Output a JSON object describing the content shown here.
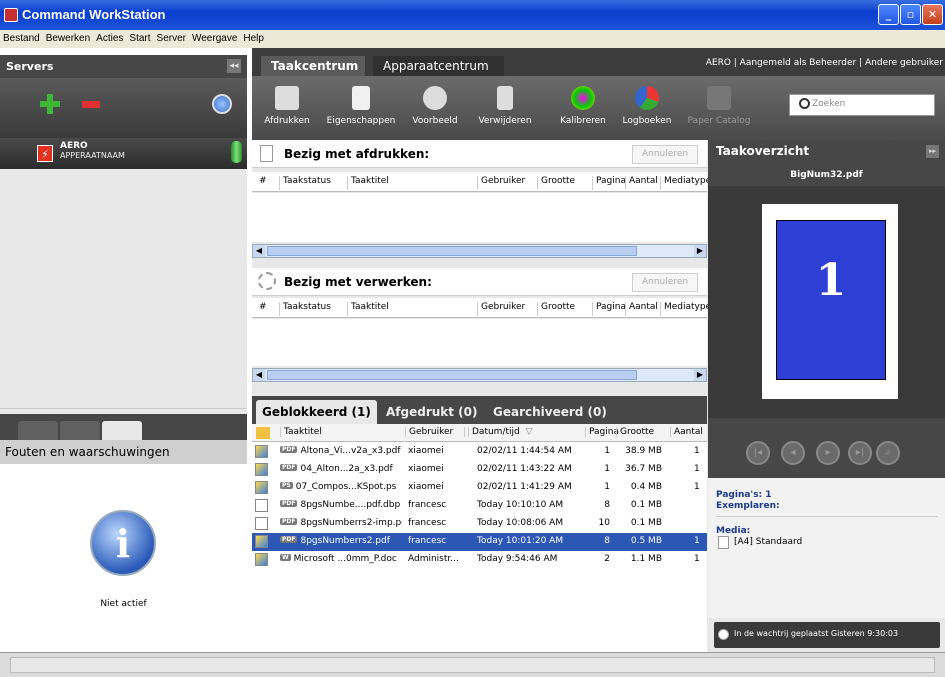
{
  "window": {
    "title": "Command WorkStation",
    "min": "_",
    "max": "▫",
    "close": "✕"
  },
  "menu": [
    "Bestand",
    "Bewerken",
    "Acties",
    "Start",
    "Server",
    "Weergave",
    "Help"
  ],
  "servers": {
    "header": "Servers",
    "collapse": "◂◂",
    "server_name": "AERO",
    "server_label": "APPERAATNAAM"
  },
  "left_tabs": [
    "job-list",
    "messages",
    "info"
  ],
  "fouten": {
    "header": "Fouten en waarschuwingen",
    "status": "Niet actief",
    "icon_glyph": "i"
  },
  "top_tabs": {
    "taak": "Taakcentrum",
    "apparaat": "Apparaatcentrum"
  },
  "user_status": "AERO | Aangemeld als Beheerder | Andere gebruiker",
  "toolbar": {
    "afdrukken": "Afdrukken",
    "eigenschappen": "Eigenschappen",
    "voorbeeld": "Voorbeeld",
    "verwijderen": "Verwijderen",
    "kalibreren": "Kalibreren",
    "logboeken": "Logboeken",
    "paper_catalog": "Paper Catalog",
    "search_placeholder": "Zoeken"
  },
  "printing": {
    "title": "Bezig met afdrukken:",
    "cancel": "Annuleren"
  },
  "processing": {
    "title": "Bezig met verwerken:",
    "cancel": "Annuleren"
  },
  "columns": [
    "#",
    "Taakstatus",
    "Taaktitel",
    "Gebruiker",
    "Grootte",
    "Pagina",
    "Aantal",
    "Mediatype"
  ],
  "bottom_tabs": {
    "geblokkeerd": "Geblokkeerd (1)",
    "afgedrukt": "Afgedrukt (0)",
    "gearchiveerd": "Gearchiveerd (0)"
  },
  "job_columns": {
    "title": "Taaktitel",
    "user": "Gebruiker",
    "datetime": "Datum/tijd",
    "sort": "▽",
    "pages": "Pagina",
    "size": "Grootte",
    "count": "Aantal"
  },
  "jobs": [
    {
      "badge": "PDF",
      "title": "Altona_Vi...v2a_x3.pdf",
      "user": "xiaomei",
      "date": "02/02/11 1:44:54 AM",
      "pages": "1",
      "size": "38.9 MB",
      "count": "1",
      "held": true
    },
    {
      "badge": "PDF",
      "title": "04_Alton...2a_x3.pdf",
      "user": "xiaomei",
      "date": "02/02/11 1:43:22 AM",
      "pages": "1",
      "size": "36.7 MB",
      "count": "1",
      "held": true
    },
    {
      "badge": "PS",
      "title": "07_Compos...KSpot.ps",
      "user": "xiaomei",
      "date": "02/02/11 1:41:29 AM",
      "pages": "1",
      "size": "0.4 MB",
      "count": "1",
      "held": true
    },
    {
      "badge": "PDF",
      "title": "8pgsNumbe....pdf.dbp",
      "user": "francesc",
      "date": "Today 10:10:10 AM",
      "pages": "8",
      "size": "0.1 MB",
      "count": "",
      "held": false
    },
    {
      "badge": "PDF",
      "title": "8pgsNumberrs2-imp.pdf",
      "user": "francesc",
      "date": "Today 10:08:06 AM",
      "pages": "10",
      "size": "0.1 MB",
      "count": "",
      "held": false
    },
    {
      "badge": "PDF",
      "title": "8pgsNumberrs2.pdf",
      "user": "francesc",
      "date": "Today 10:01:20 AM",
      "pages": "8",
      "size": "0.5 MB",
      "count": "1",
      "held": true,
      "selected": true
    },
    {
      "badge": "W",
      "title": "Microsoft ...0mm_P.doc",
      "user": "Administr...",
      "date": "Today 9:54:46 AM",
      "pages": "2",
      "size": "1.1 MB",
      "count": "1",
      "held": true
    }
  ],
  "overview": {
    "header": "Taakoverzicht",
    "expand": "▸▸",
    "file": "BigNum32.pdf",
    "preview_number": "1",
    "pages_label": "Pagina's: 1",
    "copies_label": "Exemplaren:",
    "media_label": "Media:",
    "media_value": "[A4] Standaard",
    "queue_status": "In de wachtrij geplaatst Gisteren  9:30:03",
    "nav": [
      "|◂",
      "◂",
      "▸",
      "▸|",
      "⌕"
    ]
  },
  "colors": {
    "selection": "#2d57b5",
    "dark_panel": "#474747",
    "accent_blue": "#1b3a8a"
  }
}
